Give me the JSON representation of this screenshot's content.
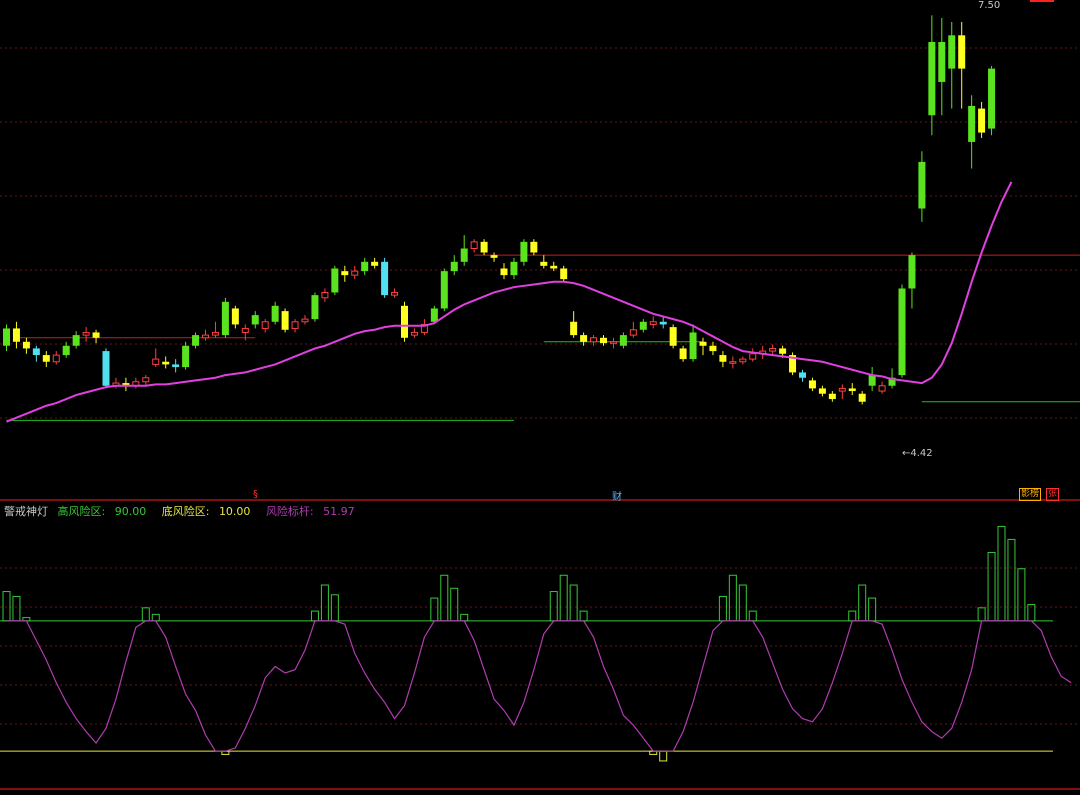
{
  "indicator": {
    "name": "警戒神灯",
    "high_label": "高风险区:",
    "high_value": "90.00",
    "low_label": "底风险区:",
    "low_value": "10.00",
    "risk_label": "风险标杆:",
    "risk_value": "51.97"
  },
  "annotations": {
    "price_high": "7.50",
    "price_low": "4.42",
    "marker_1": "§",
    "marker_2": "财",
    "marker_3": "影榜",
    "marker_4": "张"
  },
  "colors": {
    "background": "#000000",
    "up_large": "#5ae31e",
    "up_small": "#ff4040",
    "down": "#ffff20",
    "down_alt": "#50e0f0",
    "ma_line": "#e040e0",
    "risk_line": "#b03cb0",
    "high_zone": "#36c836",
    "low_zone": "#e6e640",
    "grid": "#6a1818",
    "frame": "#ff2020"
  },
  "chart_data": [
    {
      "type": "candlestick",
      "price_ylim": [
        3.9,
        7.6
      ],
      "candles": [
        {
          "o": 5.02,
          "c": 5.15,
          "h": 5.18,
          "l": 4.98
        },
        {
          "o": 5.15,
          "c": 5.05,
          "h": 5.2,
          "l": 5.0
        },
        {
          "o": 5.05,
          "c": 5.0,
          "h": 5.08,
          "l": 4.96
        },
        {
          "o": 5.0,
          "c": 4.95,
          "h": 5.02,
          "l": 4.9
        },
        {
          "o": 4.95,
          "c": 4.9,
          "h": 4.98,
          "l": 4.86
        },
        {
          "o": 4.9,
          "c": 4.95,
          "h": 4.98,
          "l": 4.88
        },
        {
          "o": 4.95,
          "c": 5.02,
          "h": 5.05,
          "l": 4.93
        },
        {
          "o": 5.02,
          "c": 5.1,
          "h": 5.13,
          "l": 5.0
        },
        {
          "o": 5.1,
          "c": 5.12,
          "h": 5.16,
          "l": 5.05
        },
        {
          "o": 5.12,
          "c": 5.08,
          "h": 5.14,
          "l": 5.04
        },
        {
          "o": 4.98,
          "c": 4.72,
          "h": 5.0,
          "l": 4.7
        },
        {
          "o": 4.72,
          "c": 4.74,
          "h": 4.78,
          "l": 4.7
        },
        {
          "o": 4.74,
          "c": 4.72,
          "h": 4.78,
          "l": 4.68
        },
        {
          "o": 4.72,
          "c": 4.75,
          "h": 4.78,
          "l": 4.7
        },
        {
          "o": 4.75,
          "c": 4.78,
          "h": 4.8,
          "l": 4.72
        },
        {
          "o": 4.88,
          "c": 4.92,
          "h": 5.0,
          "l": 4.86
        },
        {
          "o": 4.9,
          "c": 4.88,
          "h": 4.94,
          "l": 4.85
        },
        {
          "o": 4.88,
          "c": 4.86,
          "h": 4.92,
          "l": 4.82
        },
        {
          "o": 4.86,
          "c": 5.02,
          "h": 5.05,
          "l": 4.84
        },
        {
          "o": 5.02,
          "c": 5.1,
          "h": 5.12,
          "l": 5.0
        },
        {
          "o": 5.08,
          "c": 5.1,
          "h": 5.14,
          "l": 5.06
        },
        {
          "o": 5.1,
          "c": 5.12,
          "h": 5.2,
          "l": 5.08
        },
        {
          "o": 5.1,
          "c": 5.35,
          "h": 5.38,
          "l": 5.08
        },
        {
          "o": 5.3,
          "c": 5.18,
          "h": 5.32,
          "l": 5.15
        },
        {
          "o": 5.12,
          "c": 5.15,
          "h": 5.18,
          "l": 5.06
        },
        {
          "o": 5.18,
          "c": 5.25,
          "h": 5.28,
          "l": 5.15
        },
        {
          "o": 5.15,
          "c": 5.2,
          "h": 5.22,
          "l": 5.12
        },
        {
          "o": 5.2,
          "c": 5.32,
          "h": 5.35,
          "l": 5.18
        },
        {
          "o": 5.28,
          "c": 5.14,
          "h": 5.3,
          "l": 5.12
        },
        {
          "o": 5.15,
          "c": 5.2,
          "h": 5.22,
          "l": 5.12
        },
        {
          "o": 5.2,
          "c": 5.22,
          "h": 5.25,
          "l": 5.18
        },
        {
          "o": 5.22,
          "c": 5.4,
          "h": 5.42,
          "l": 5.2
        },
        {
          "o": 5.38,
          "c": 5.42,
          "h": 5.45,
          "l": 5.35
        },
        {
          "o": 5.42,
          "c": 5.6,
          "h": 5.62,
          "l": 5.4
        },
        {
          "o": 5.58,
          "c": 5.55,
          "h": 5.62,
          "l": 5.5
        },
        {
          "o": 5.55,
          "c": 5.58,
          "h": 5.62,
          "l": 5.52
        },
        {
          "o": 5.58,
          "c": 5.65,
          "h": 5.68,
          "l": 5.55
        },
        {
          "o": 5.65,
          "c": 5.62,
          "h": 5.68,
          "l": 5.6
        },
        {
          "o": 5.65,
          "c": 5.4,
          "h": 5.68,
          "l": 5.38
        },
        {
          "o": 5.4,
          "c": 5.42,
          "h": 5.45,
          "l": 5.38
        },
        {
          "o": 5.32,
          "c": 5.08,
          "h": 5.35,
          "l": 5.05
        },
        {
          "o": 5.1,
          "c": 5.12,
          "h": 5.15,
          "l": 5.08
        },
        {
          "o": 5.12,
          "c": 5.18,
          "h": 5.22,
          "l": 5.1
        },
        {
          "o": 5.2,
          "c": 5.3,
          "h": 5.32,
          "l": 5.18
        },
        {
          "o": 5.3,
          "c": 5.58,
          "h": 5.6,
          "l": 5.28
        },
        {
          "o": 5.58,
          "c": 5.65,
          "h": 5.7,
          "l": 5.55
        },
        {
          "o": 5.65,
          "c": 5.75,
          "h": 5.85,
          "l": 5.62
        },
        {
          "o": 5.75,
          "c": 5.8,
          "h": 5.82,
          "l": 5.72
        },
        {
          "o": 5.8,
          "c": 5.72,
          "h": 5.82,
          "l": 5.7
        },
        {
          "o": 5.7,
          "c": 5.68,
          "h": 5.72,
          "l": 5.65
        },
        {
          "o": 5.6,
          "c": 5.55,
          "h": 5.64,
          "l": 5.52
        },
        {
          "o": 5.55,
          "c": 5.65,
          "h": 5.68,
          "l": 5.52
        },
        {
          "o": 5.65,
          "c": 5.8,
          "h": 5.82,
          "l": 5.62
        },
        {
          "o": 5.8,
          "c": 5.72,
          "h": 5.82,
          "l": 5.7
        },
        {
          "o": 5.65,
          "c": 5.62,
          "h": 5.7,
          "l": 5.6
        },
        {
          "o": 5.62,
          "c": 5.6,
          "h": 5.65,
          "l": 5.58
        },
        {
          "o": 5.6,
          "c": 5.52,
          "h": 5.62,
          "l": 5.5
        },
        {
          "o": 5.2,
          "c": 5.1,
          "h": 5.28,
          "l": 5.08
        },
        {
          "o": 5.1,
          "c": 5.05,
          "h": 5.12,
          "l": 5.02
        },
        {
          "o": 5.05,
          "c": 5.08,
          "h": 5.1,
          "l": 5.02
        },
        {
          "o": 5.08,
          "c": 5.04,
          "h": 5.1,
          "l": 5.02
        },
        {
          "o": 5.04,
          "c": 5.05,
          "h": 5.08,
          "l": 5.0
        },
        {
          "o": 5.02,
          "c": 5.1,
          "h": 5.12,
          "l": 5.0
        },
        {
          "o": 5.1,
          "c": 5.14,
          "h": 5.2,
          "l": 5.08
        },
        {
          "o": 5.14,
          "c": 5.2,
          "h": 5.22,
          "l": 5.12
        },
        {
          "o": 5.18,
          "c": 5.2,
          "h": 5.24,
          "l": 5.15
        },
        {
          "o": 5.2,
          "c": 5.18,
          "h": 5.24,
          "l": 5.15
        },
        {
          "o": 5.16,
          "c": 5.02,
          "h": 5.18,
          "l": 5.0
        },
        {
          "o": 5.0,
          "c": 4.92,
          "h": 5.02,
          "l": 4.9
        },
        {
          "o": 4.92,
          "c": 5.12,
          "h": 5.18,
          "l": 4.9
        },
        {
          "o": 5.05,
          "c": 5.02,
          "h": 5.08,
          "l": 4.95
        },
        {
          "o": 5.02,
          "c": 4.98,
          "h": 5.05,
          "l": 4.95
        },
        {
          "o": 4.95,
          "c": 4.9,
          "h": 4.98,
          "l": 4.86
        },
        {
          "o": 4.9,
          "c": 4.9,
          "h": 4.94,
          "l": 4.85
        },
        {
          "o": 4.9,
          "c": 4.92,
          "h": 4.94,
          "l": 4.88
        },
        {
          "o": 4.92,
          "c": 4.96,
          "h": 5.0,
          "l": 4.9
        },
        {
          "o": 4.96,
          "c": 4.98,
          "h": 5.02,
          "l": 4.92
        },
        {
          "o": 4.98,
          "c": 5.0,
          "h": 5.03,
          "l": 4.95
        },
        {
          "o": 5.0,
          "c": 4.96,
          "h": 5.02,
          "l": 4.93
        },
        {
          "o": 4.95,
          "c": 4.82,
          "h": 4.97,
          "l": 4.8
        },
        {
          "o": 4.82,
          "c": 4.78,
          "h": 4.84,
          "l": 4.75
        },
        {
          "o": 4.76,
          "c": 4.7,
          "h": 4.78,
          "l": 4.68
        },
        {
          "o": 4.7,
          "c": 4.66,
          "h": 4.72,
          "l": 4.64
        },
        {
          "o": 4.66,
          "c": 4.62,
          "h": 4.68,
          "l": 4.6
        },
        {
          "o": 4.68,
          "c": 4.7,
          "h": 4.73,
          "l": 4.62
        },
        {
          "o": 4.7,
          "c": 4.68,
          "h": 4.74,
          "l": 4.65
        },
        {
          "o": 4.66,
          "c": 4.6,
          "h": 4.68,
          "l": 4.58
        },
        {
          "o": 4.72,
          "c": 4.8,
          "h": 4.86,
          "l": 4.68
        },
        {
          "o": 4.68,
          "c": 4.72,
          "h": 4.75,
          "l": 4.66
        },
        {
          "o": 4.72,
          "c": 4.78,
          "h": 4.85,
          "l": 4.7
        },
        {
          "o": 4.8,
          "c": 5.45,
          "h": 5.48,
          "l": 4.78
        },
        {
          "o": 5.45,
          "c": 5.7,
          "h": 5.72,
          "l": 5.3
        },
        {
          "o": 6.05,
          "c": 6.4,
          "h": 6.48,
          "l": 5.95
        },
        {
          "o": 6.75,
          "c": 7.3,
          "h": 7.5,
          "l": 6.6
        },
        {
          "o": 7.0,
          "c": 7.3,
          "h": 7.48,
          "l": 6.75
        },
        {
          "o": 7.1,
          "c": 7.35,
          "h": 7.45,
          "l": 6.8
        },
        {
          "o": 7.35,
          "c": 7.1,
          "h": 7.45,
          "l": 6.8
        },
        {
          "o": 6.55,
          "c": 6.82,
          "h": 6.9,
          "l": 6.35
        },
        {
          "o": 6.8,
          "c": 6.62,
          "h": 6.85,
          "l": 6.58
        },
        {
          "o": 6.65,
          "c": 7.1,
          "h": 7.12,
          "l": 6.6
        }
      ],
      "ma": [
        4.45,
        4.48,
        4.51,
        4.54,
        4.57,
        4.59,
        4.62,
        4.65,
        4.67,
        4.69,
        4.71,
        4.72,
        4.72,
        4.72,
        4.72,
        4.73,
        4.73,
        4.74,
        4.75,
        4.76,
        4.77,
        4.78,
        4.8,
        4.81,
        4.82,
        4.84,
        4.86,
        4.88,
        4.91,
        4.94,
        4.97,
        5.0,
        5.02,
        5.05,
        5.08,
        5.11,
        5.13,
        5.14,
        5.16,
        5.17,
        5.17,
        5.17,
        5.17,
        5.19,
        5.24,
        5.29,
        5.33,
        5.36,
        5.39,
        5.42,
        5.44,
        5.46,
        5.47,
        5.48,
        5.49,
        5.5,
        5.5,
        5.49,
        5.47,
        5.44,
        5.41,
        5.38,
        5.35,
        5.32,
        5.29,
        5.26,
        5.24,
        5.22,
        5.2,
        5.17,
        5.13,
        5.09,
        5.05,
        5.01,
        4.98,
        4.97,
        4.96,
        4.95,
        4.94,
        4.93,
        4.92,
        4.91,
        4.9,
        4.88,
        4.86,
        4.84,
        4.82,
        4.8,
        4.79,
        4.77,
        4.76,
        4.75,
        4.74,
        4.78,
        4.88,
        5.04,
        5.26,
        5.5,
        5.72,
        5.92,
        6.1,
        6.25
      ],
      "support_lines": [
        {
          "value": 4.46,
          "from": 0,
          "to": 51
        },
        {
          "value": 5.05,
          "from": 54,
          "to": 70
        },
        {
          "value": 4.6,
          "from": 92,
          "to": 109
        }
      ],
      "resistance_lines": [
        {
          "value": 5.08,
          "from": 1,
          "to": 25
        },
        {
          "value": 5.7,
          "from": 47,
          "to": 110
        }
      ]
    },
    {
      "type": "line",
      "name": "警戒神灯",
      "ylim": [
        -12,
        155
      ],
      "high_zone": 90,
      "low_zone": 10,
      "risk": [
        108,
        105,
        92,
        78,
        66,
        52,
        40,
        30,
        22,
        15,
        24,
        42,
        65,
        86,
        98,
        94,
        80,
        62,
        45,
        35,
        20,
        10,
        8,
        12,
        24,
        38,
        55,
        62,
        58,
        60,
        72,
        96,
        112,
        106,
        88,
        70,
        58,
        48,
        40,
        30,
        38,
        58,
        80,
        104,
        118,
        110,
        94,
        78,
        60,
        42,
        35,
        26,
        40,
        60,
        82,
        108,
        118,
        112,
        96,
        80,
        62,
        48,
        32,
        26,
        18,
        8,
        4,
        10,
        22,
        40,
        62,
        84,
        105,
        118,
        112,
        96,
        80,
        64,
        48,
        36,
        30,
        28,
        36,
        52,
        70,
        96,
        112,
        104,
        88,
        72,
        54,
        40,
        28,
        22,
        18,
        24,
        40,
        60,
        98,
        132,
        148,
        140,
        122,
        100,
        84,
        68,
        56,
        52
      ]
    }
  ]
}
